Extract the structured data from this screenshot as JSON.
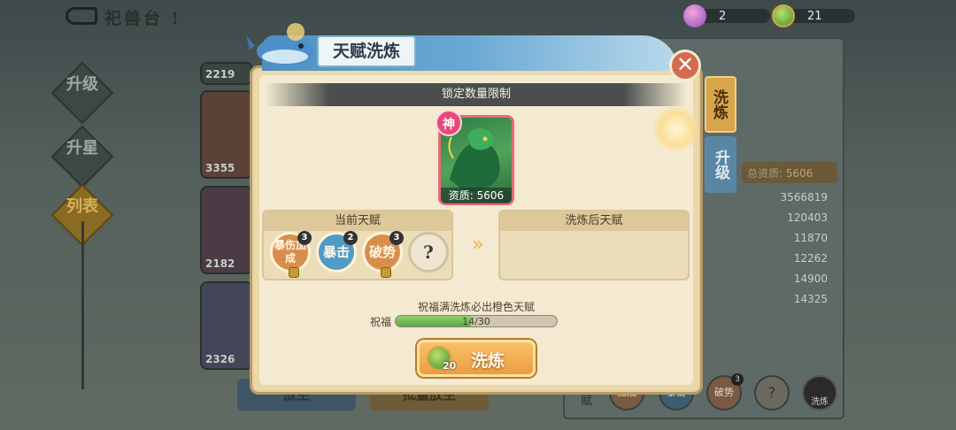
{
  "scene": {
    "title": "祀兽台 !",
    "side_tabs": [
      "升级",
      "升星",
      "列表"
    ],
    "active_tab": "列表",
    "card_numbers": [
      "2219",
      "3355",
      "2182",
      "2326"
    ],
    "bottom_buttons": [
      "放生",
      "批量放生"
    ]
  },
  "currency": {
    "gems": "2",
    "coins": "21"
  },
  "right_panel": {
    "tabs": [
      "洗炼",
      "升级"
    ],
    "total_label": "总资质:",
    "total_value": "5606",
    "stats": [
      "3566819",
      "120403",
      "11870",
      "12262",
      "14900",
      "14325"
    ],
    "talent_row_label": "赋",
    "talent_labels": [
      "加成",
      "暴击",
      "破势",
      "?",
      "洗炼"
    ],
    "talent_badge": "3"
  },
  "modal": {
    "title": "天赋洗炼",
    "banner": "锁定数量限制",
    "portrait_stamp": "神",
    "portrait_quality": "资质: 5606",
    "current_title": "当前天赋",
    "after_title": "洗炼后天赋",
    "talents": [
      {
        "name": "暴伤加成",
        "level": "3",
        "color": "#d98d4c",
        "locked": true
      },
      {
        "name": "暴击",
        "level": "2",
        "color": "#4f9bc7",
        "locked": false
      },
      {
        "name": "破势",
        "level": "3",
        "color": "#d98d4c",
        "locked": true
      },
      {
        "name": "?",
        "level": "",
        "color": "#eee6d2",
        "locked": false
      }
    ],
    "bless_note": "祝福满洗炼必出橙色天赋",
    "bless_label": "祝福",
    "bless_progress_text": "14/30",
    "bless_progress": 0.467,
    "refine_cost": "20",
    "refine_label": "洗炼"
  },
  "colors": {
    "accent_orange": "#ec9d3f",
    "panel_cream": "#f4ead1",
    "title_blue": "#6aa9d5"
  }
}
